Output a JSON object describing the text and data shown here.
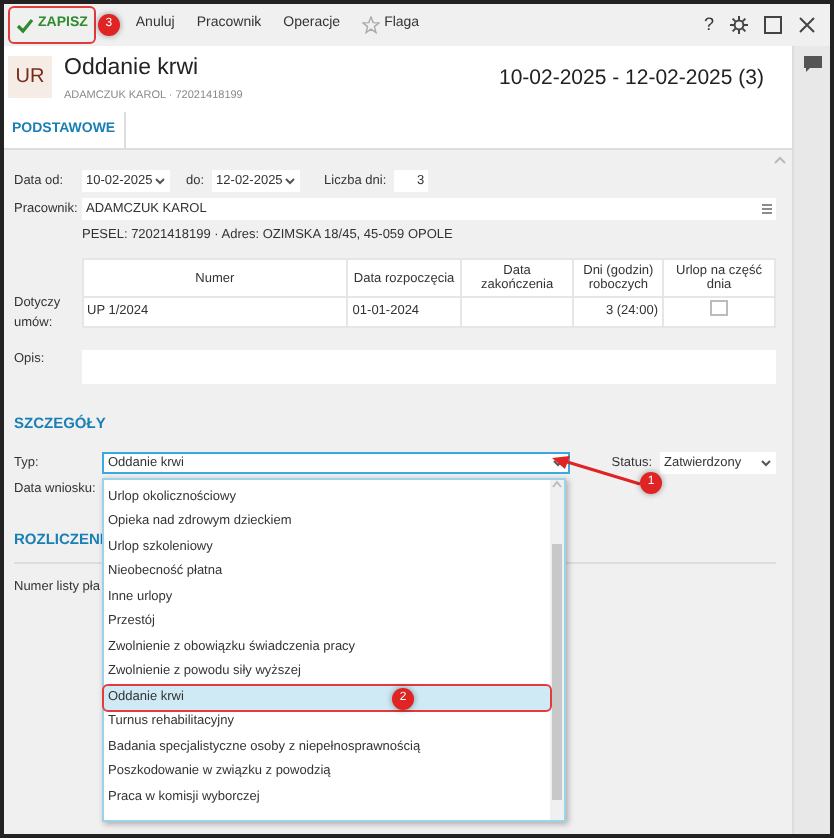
{
  "toolbar": {
    "save_button": {
      "label": "ZAPISZ",
      "highlighted": true,
      "callout": "3"
    },
    "items": [
      {
        "label": "Anuluj",
        "kind": "text"
      },
      {
        "label": "Pracownik",
        "kind": "text"
      },
      {
        "label": "Operacje",
        "kind": "text"
      },
      {
        "label": "Flaga",
        "kind": "star"
      }
    ],
    "help": "?"
  },
  "header": {
    "badge": "UR",
    "title": "Oddanie krwi",
    "subtitle": "ADAMCZUK KAROL  ·  72021418199",
    "period": "10-02-2025 - 12-02-2025 (3)"
  },
  "tabs": [
    {
      "label": "PODSTAWOWE",
      "selected": true
    }
  ],
  "form": {
    "date_from": {
      "label": "Data od:",
      "value": "10-02-2025"
    },
    "date_to": {
      "label": "do:",
      "value": "12-02-2025"
    },
    "days": {
      "label": "Liczba dni:",
      "value": "3"
    },
    "employee": {
      "label": "Pracownik:",
      "value": "ADAMCZUK KAROL",
      "details": "PESEL:  72021418199  ·  Adres:  OZIMSKA 18/45, 45-059 OPOLE"
    },
    "contracts": {
      "label": "Dotyczy umów:",
      "columns": [
        "Numer",
        "Data rozpoczęcia",
        "Data zakończenia",
        "Dni (godzin) roboczych",
        "Urlop na część dnia"
      ],
      "rows": [
        {
          "cells": [
            "UP 1/2024",
            "01-01-2024",
            "",
            "3  (24:00)"
          ],
          "part_day": false
        }
      ]
    },
    "description": {
      "label": "Opis:"
    }
  },
  "details": {
    "title": "SZCZEGÓŁY",
    "type": {
      "label": "Typ:",
      "value": "Oddanie krwi",
      "callout": "1"
    },
    "status": {
      "label": "Status:",
      "value": "Zatwierdzony"
    },
    "request_date": {
      "label": "Data wniosku:"
    }
  },
  "settlement": {
    "title": "ROZLICZENI",
    "payroll_label": "Numer listy pła"
  },
  "dropdown": {
    "options": [
      {
        "label": "Urlop okolicznościowy",
        "selected": false
      },
      {
        "label": "Opieka nad zdrowym dzieckiem",
        "selected": false
      },
      {
        "label": "Urlop szkoleniowy",
        "selected": false
      },
      {
        "label": "Nieobecność płatna",
        "selected": false
      },
      {
        "label": "Inne urlopy",
        "selected": false
      },
      {
        "label": "Przestój",
        "selected": false
      },
      {
        "label": "Zwolnienie z obowiązku świadczenia pracy",
        "selected": false
      },
      {
        "label": "Zwolnienie z powodu siły wyższej",
        "selected": false
      },
      {
        "label": "Oddanie krwi",
        "selected": true,
        "highlighted": true,
        "callout": "2"
      },
      {
        "label": "Turnus rehabilitacyjny",
        "selected": false
      },
      {
        "label": "Badania specjalistyczne osoby z niepełnosprawnością",
        "selected": false
      },
      {
        "label": "Poszkodowanie w związku z powodzią",
        "selected": false
      },
      {
        "label": "Praca w komisji wyborczej",
        "selected": false
      }
    ]
  }
}
